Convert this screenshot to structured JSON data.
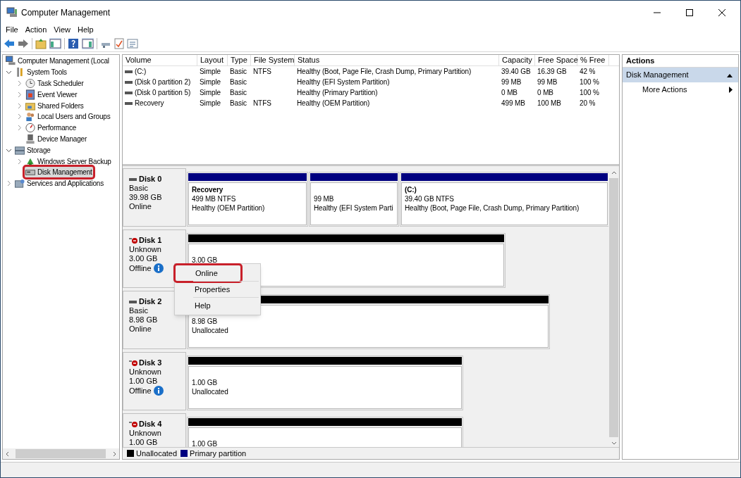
{
  "window": {
    "title": "Computer Management"
  },
  "menu": [
    "File",
    "Action",
    "View",
    "Help"
  ],
  "tree": [
    {
      "label": "Computer Management (Local",
      "selected": false,
      "outlined": false,
      "children": [
        {
          "label": "System Tools",
          "expanded": true,
          "selected": false,
          "outlined": false,
          "children": [
            {
              "label": "Task Scheduler",
              "expanded": false,
              "selected": false,
              "outlined": false
            },
            {
              "label": "Event Viewer",
              "expanded": false,
              "selected": false,
              "outlined": false
            },
            {
              "label": "Shared Folders",
              "expanded": false,
              "selected": false,
              "outlined": false
            },
            {
              "label": "Local Users and Groups",
              "expanded": false,
              "selected": false,
              "outlined": false
            },
            {
              "label": "Performance",
              "expanded": false,
              "selected": false,
              "outlined": false
            },
            {
              "label": "Device Manager",
              "selected": false,
              "outlined": false
            }
          ]
        },
        {
          "label": "Storage",
          "expanded": true,
          "selected": false,
          "outlined": false,
          "children": [
            {
              "label": "Windows Server Backup",
              "expanded": false,
              "selected": false,
              "outlined": false
            },
            {
              "label": "Disk Management",
              "selected": true,
              "outlined": true
            }
          ]
        },
        {
          "label": "Services and Applications",
          "expanded": false,
          "selected": false,
          "outlined": false
        }
      ]
    }
  ],
  "table": {
    "columns": [
      "Volume",
      "Layout",
      "Type",
      "File System",
      "Status",
      "Capacity",
      "Free Space",
      "% Free"
    ],
    "rows": [
      {
        "cells": [
          "(C:)",
          "Simple",
          "Basic",
          "NTFS",
          "Healthy (Boot, Page File, Crash Dump, Primary Partition)",
          "39.40 GB",
          "16.39 GB",
          "42 %"
        ]
      },
      {
        "cells": [
          "(Disk 0 partition 2)",
          "Simple",
          "Basic",
          null,
          "Healthy (EFI System Partition)",
          "99 MB",
          "99 MB",
          "100 %"
        ]
      },
      {
        "cells": [
          "(Disk 0 partition 5)",
          "Simple",
          "Basic",
          null,
          "Healthy (Primary Partition)",
          "0 MB",
          "0 MB",
          "100 %"
        ]
      },
      {
        "cells": [
          "Recovery",
          "Simple",
          "Basic",
          "NTFS",
          "Healthy (OEM Partition)",
          "499 MB",
          "100 MB",
          "20 %"
        ]
      }
    ]
  },
  "disks": [
    {
      "name": "Disk 0",
      "kind": "basic",
      "type": "Basic",
      "size": "39.98 GB",
      "status": "Online",
      "info": false,
      "partitions": [
        {
          "kind": "primary",
          "name": "Recovery",
          "size": "499 MB NTFS",
          "status": "Healthy (OEM Partition)"
        },
        {
          "kind": "primary",
          "size": "99 MB",
          "status": "Healthy (EFI System Parti"
        },
        {
          "kind": "primary",
          "name": "(C:)",
          "size": "39.40 GB NTFS",
          "status": "Healthy (Boot, Page File, Crash Dump, Primary Partition)"
        }
      ]
    },
    {
      "name": "Disk 1",
      "kind": "unknown",
      "type": "Unknown",
      "size": "3.00 GB",
      "status": "Offline",
      "info": true,
      "partitions": [
        {
          "kind": "unallocated",
          "size": "3.00 GB"
        }
      ]
    },
    {
      "name": "Disk 2",
      "kind": "basic",
      "type": "Basic",
      "size": "8.98 GB",
      "status": "Online",
      "info": false,
      "partitions": [
        {
          "kind": "unallocated",
          "size": "8.98 GB",
          "status": "Unallocated"
        }
      ]
    },
    {
      "name": "Disk 3",
      "kind": "unknown",
      "type": "Unknown",
      "size": "1.00 GB",
      "status": "Offline",
      "info": true,
      "partitions": [
        {
          "kind": "unallocated",
          "size": "1.00 GB",
          "status": "Unallocated"
        }
      ]
    },
    {
      "name": "Disk 4",
      "kind": "unknown",
      "type": "Unknown",
      "size": "1.00 GB",
      "info": false,
      "partitions": [
        {
          "kind": "unallocated",
          "size": "1.00 GB"
        }
      ]
    }
  ],
  "legend": [
    {
      "label": "Unallocated",
      "color": "#000000"
    },
    {
      "label": "Primary partition",
      "color": "#000080"
    }
  ],
  "actions": {
    "title": "Actions",
    "section": {
      "label": "Disk Management",
      "expanded": true
    },
    "items": [
      "More Actions"
    ]
  },
  "context_menu": [
    {
      "label": "Online",
      "outlined": true
    },
    {
      "label": "Properties",
      "outlined": false
    },
    {
      "label": "Help",
      "outlined": false
    }
  ]
}
